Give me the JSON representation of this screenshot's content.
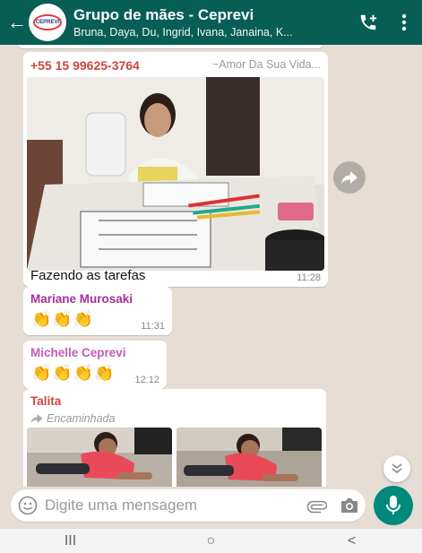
{
  "header": {
    "back_icon": "arrow-left-icon",
    "avatar_logo_text": "CEPREVI",
    "title": "Grupo de mães - Ceprevi",
    "subtitle": "Bruna, Daya, Du, Ingrid, Ivana, Janaina, K...",
    "call_icon": "add-call-icon",
    "menu_icon": "more-vertical-icon",
    "bg_color": "#075e54"
  },
  "messages": [
    {
      "sender": "+55 15 99625-3764",
      "alias": "~Amor Da Sua Vida...",
      "type": "image",
      "caption": "Fazendo as tarefas",
      "time": "11:28",
      "sender_color": "#d0453c"
    },
    {
      "sender": "Mariane Murosaki",
      "type": "text",
      "content": "👏👏👏",
      "time": "11:31",
      "sender_color": "#a62f95"
    },
    {
      "sender": "Michelle Ceprevi",
      "type": "text",
      "content": "👏👏👏👏",
      "time": "12:12",
      "sender_color": "#c45ab5"
    },
    {
      "sender": "Talita",
      "forwarded_label": "Encaminhada",
      "type": "images",
      "sender_color": "#d0453c"
    }
  ],
  "input": {
    "placeholder": "Digite uma mensagem",
    "emoji_icon": "emoji-icon",
    "attach_icon": "paperclip-icon",
    "camera_icon": "camera-icon",
    "mic_icon": "mic-icon",
    "accent": "#00897b"
  },
  "navbar": {
    "recent": "III",
    "home": "○",
    "back": "<"
  }
}
